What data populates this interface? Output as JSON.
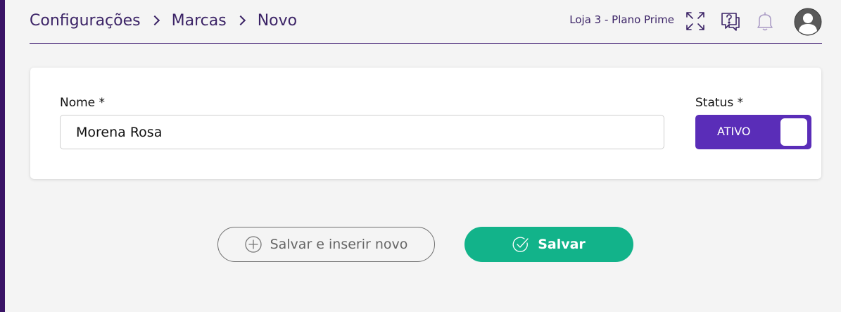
{
  "breadcrumb": {
    "items": [
      "Configurações",
      "Marcas",
      "Novo"
    ]
  },
  "header": {
    "store": "Loja 3 - Plano Prime",
    "icons": [
      "expand-icon",
      "help-chat-icon",
      "bell-icon",
      "user-avatar-icon"
    ]
  },
  "form": {
    "name_label": "Nome *",
    "name_value": "Morena Rosa",
    "status_label": "Status *",
    "status_value": "ATIVO"
  },
  "actions": {
    "save_and_new_label": "Salvar e inserir novo",
    "save_label": "Salvar"
  },
  "colors": {
    "accent_purple": "#5a2db8",
    "text_purple": "#3b2366",
    "success_green": "#12b38a",
    "rail": "#3a1466"
  }
}
